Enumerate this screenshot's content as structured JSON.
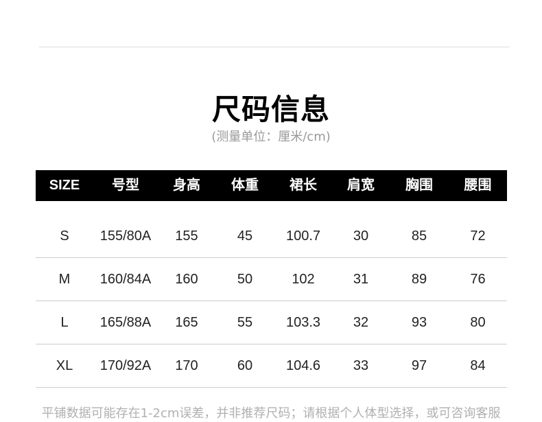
{
  "title": "尺码信息",
  "subtitle": "(测量单位：厘米/cm)",
  "table": {
    "headers": [
      "SIZE",
      "号型",
      "身高",
      "体重",
      "裙长",
      "肩宽",
      "胸围",
      "腰围"
    ],
    "rows": [
      [
        "S",
        "155/80A",
        "155",
        "45",
        "100.7",
        "30",
        "85",
        "72"
      ],
      [
        "M",
        "160/84A",
        "160",
        "50",
        "102",
        "31",
        "89",
        "76"
      ],
      [
        "L",
        "165/88A",
        "165",
        "55",
        "103.3",
        "32",
        "93",
        "80"
      ],
      [
        "XL",
        "170/92A",
        "170",
        "60",
        "104.6",
        "33",
        "97",
        "84"
      ]
    ]
  },
  "footnote": "平铺数据可能存在1-2cm误差，并非推荐尺码；请根据个人体型选择，或可咨询客服",
  "colors": {
    "header_background": "#000000",
    "header_text": "#ffffff",
    "divider": "#cccccc",
    "subtitle": "#9a9a9a",
    "footnote": "#b0b0b0",
    "cell_text": "#222222"
  }
}
